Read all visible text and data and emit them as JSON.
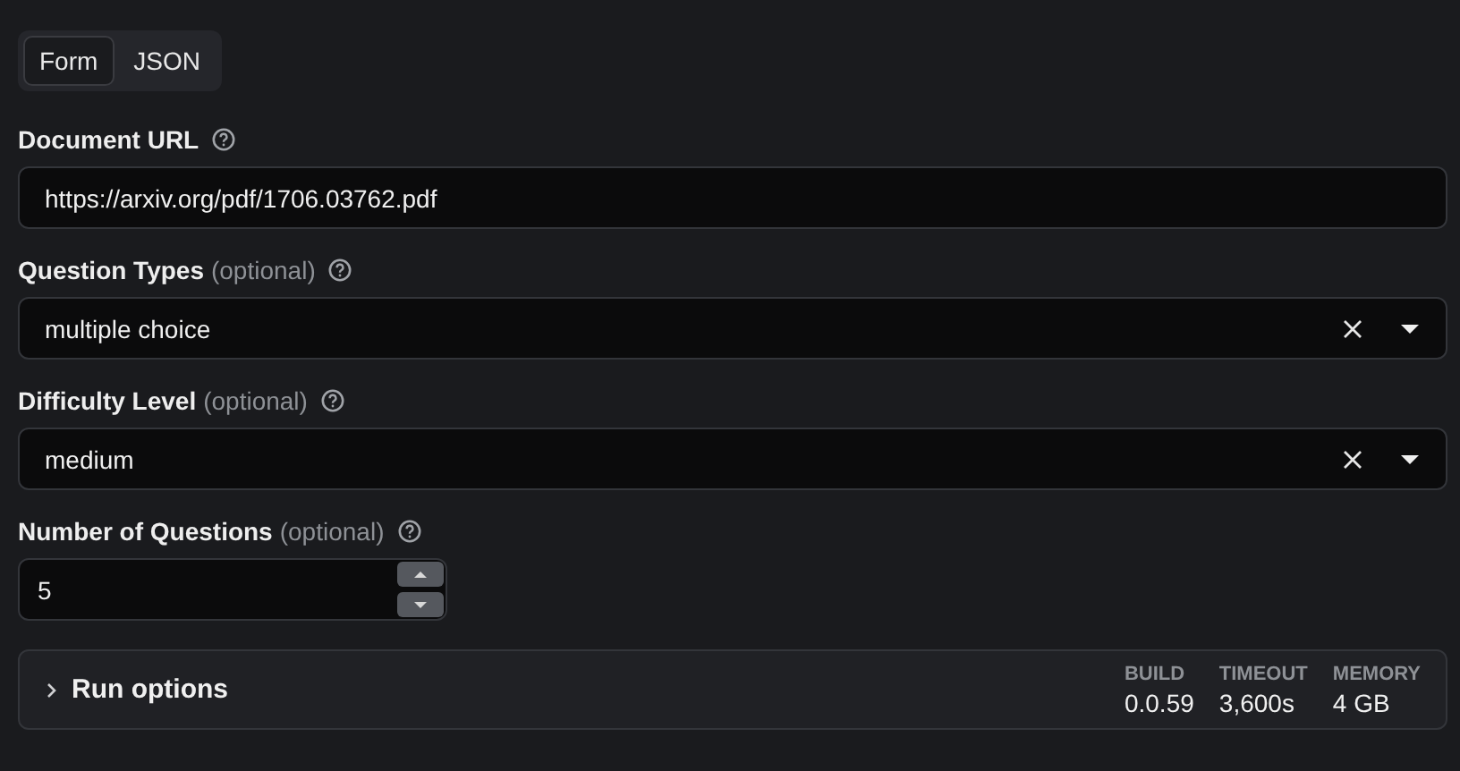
{
  "tabs": [
    {
      "label": "Form",
      "selected": true
    },
    {
      "label": "JSON",
      "selected": false
    }
  ],
  "fields": [
    {
      "kind": "text",
      "label": "Document URL",
      "value": "https://arxiv.org/pdf/1706.03762.pdf"
    },
    {
      "kind": "select",
      "label": "Question Types",
      "optional_note": "(optional)",
      "value": "multiple choice"
    },
    {
      "kind": "select",
      "label": "Difficulty Level",
      "optional_note": "(optional)",
      "value": "medium"
    },
    {
      "kind": "number",
      "label": "Number of Questions",
      "optional_note": "(optional)",
      "value": "5"
    }
  ],
  "run_options": {
    "title": "Run options",
    "expanded": false,
    "stats": [
      {
        "label": "BUILD",
        "value": "0.0.59"
      },
      {
        "label": "TIMEOUT",
        "value": "3,600s"
      },
      {
        "label": "MEMORY",
        "value": "4 GB"
      }
    ]
  }
}
